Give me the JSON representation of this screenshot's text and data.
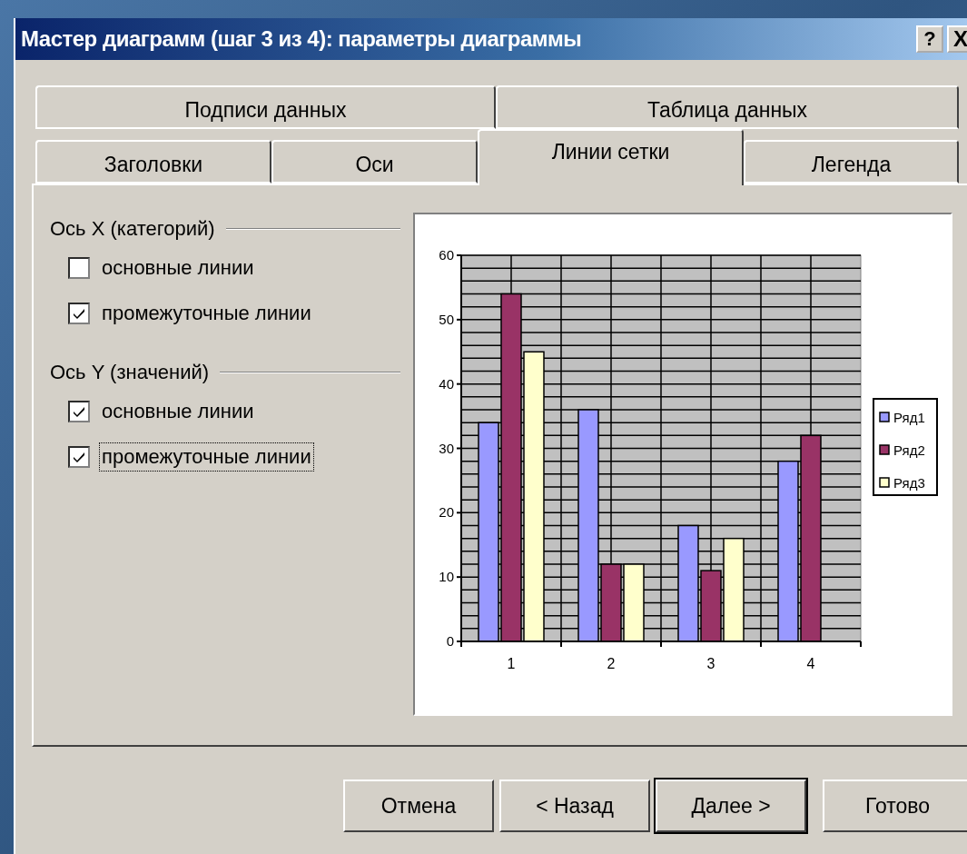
{
  "window": {
    "title": "Мастер диаграмм (шаг 3 из 4): параметры диаграммы",
    "controls": [
      {
        "kind": "help",
        "label": "?"
      },
      {
        "kind": "close",
        "label": "X"
      }
    ]
  },
  "tab_rows": [
    {
      "tabs": [
        {
          "label": "Подписи данных",
          "selected": false
        },
        {
          "label": "Таблица данных",
          "selected": false
        }
      ]
    },
    {
      "tabs": [
        {
          "label": "Заголовки",
          "selected": false
        },
        {
          "label": "Оси",
          "selected": false
        },
        {
          "label": "Линии сетки",
          "selected": true
        },
        {
          "label": "Легенда",
          "selected": false
        }
      ]
    }
  ],
  "groups": [
    {
      "title": "Ось X (категорий)",
      "options": [
        {
          "label": "основные линии",
          "checked": false,
          "focused": false
        },
        {
          "label": "промежуточные линии",
          "checked": true,
          "focused": false
        }
      ]
    },
    {
      "title": "Ось Y (значений)",
      "options": [
        {
          "label": "основные линии",
          "checked": true,
          "focused": false
        },
        {
          "label": "промежуточные линии",
          "checked": true,
          "focused": true
        }
      ]
    }
  ],
  "preview": {
    "chart_data": {
      "type": "bar",
      "grid": {
        "x": true,
        "y": true
      },
      "legend": true,
      "categories": [
        "1",
        "2",
        "3",
        "4"
      ],
      "ylim": [
        0,
        60
      ],
      "yticks": [
        0,
        10,
        20,
        30,
        40,
        50,
        60
      ],
      "series": [
        {
          "name": "Ряд1",
          "color": "#9999ff",
          "values": [
            34,
            36,
            18,
            28
          ]
        },
        {
          "name": "Ряд2",
          "color": "#993366",
          "values": [
            54,
            12,
            11,
            32
          ]
        },
        {
          "name": "Ряд3",
          "color": "#ffffcc",
          "values": [
            45,
            12,
            16,
            null
          ]
        }
      ]
    }
  },
  "buttons": [
    {
      "label": "Отмена",
      "default": false
    },
    {
      "label": "< Назад",
      "default": false
    },
    {
      "label": "Далее >",
      "default": true
    },
    {
      "label": "Готово",
      "default": false
    }
  ]
}
